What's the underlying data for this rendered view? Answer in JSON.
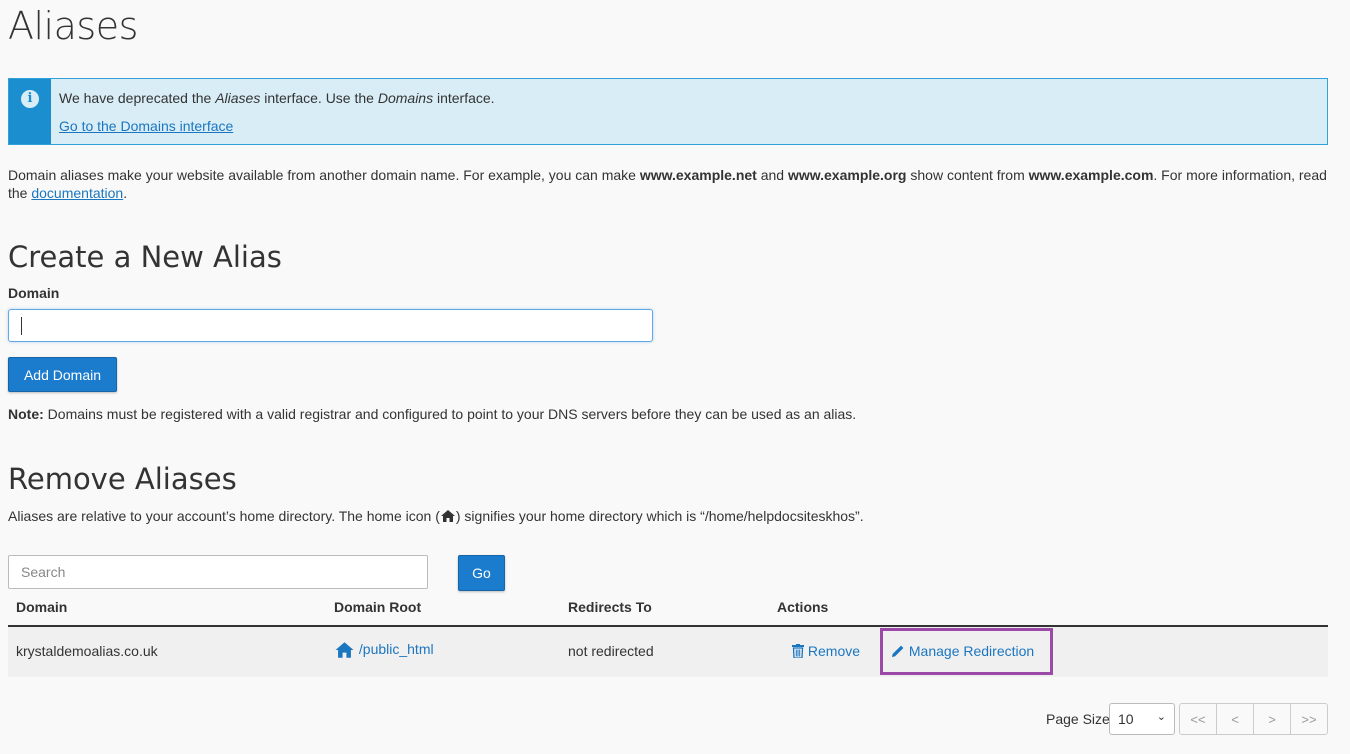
{
  "page": {
    "title": "Aliases"
  },
  "notice": {
    "message_pre": "We have deprecated the ",
    "message_em1": "Aliases",
    "message_mid": " interface. Use the ",
    "message_em2": "Domains",
    "message_post": " interface.",
    "link": "Go to the Domains interface"
  },
  "intro": {
    "part1": "Domain aliases make your website available from another domain name. For example, you can make ",
    "bold1": "www.example.net",
    "part2": " and ",
    "bold2": "www.example.org",
    "part3": " show content from ",
    "bold3": "www.example.com",
    "part4": ". For more information, read the ",
    "link": "documentation",
    "part5": "."
  },
  "create": {
    "heading": "Create a New Alias",
    "domain_label": "Domain",
    "domain_value": "",
    "add_button": "Add Domain",
    "note_label": "Note:",
    "note_text": " Domains must be registered with a valid registrar and configured to point to your DNS servers before they can be used as an alias."
  },
  "remove": {
    "heading": "Remove Aliases",
    "desc_pre": "Aliases are relative to your account’s home directory. The home icon (",
    "desc_post": ") signifies your home directory which is “/home/helpdocsiteskhos”.",
    "search_placeholder": "Search",
    "go_button": "Go"
  },
  "table": {
    "columns": [
      "Domain",
      "Domain Root",
      "Redirects To",
      "Actions"
    ],
    "rows": [
      {
        "domain": "krystaldemoalias.co.uk",
        "root": "/public_html",
        "redirects": "not redirected",
        "remove": "Remove",
        "manage": "Manage Redirection"
      }
    ]
  },
  "pagination": {
    "page_size_label": "Page Size",
    "page_size": "10",
    "first": "<<",
    "prev": "<",
    "next": ">",
    "last": ">>"
  },
  "colors": {
    "accent": "#1b7bcc",
    "alert_bg": "#d9edf7",
    "highlight": "#9b4aa8"
  }
}
